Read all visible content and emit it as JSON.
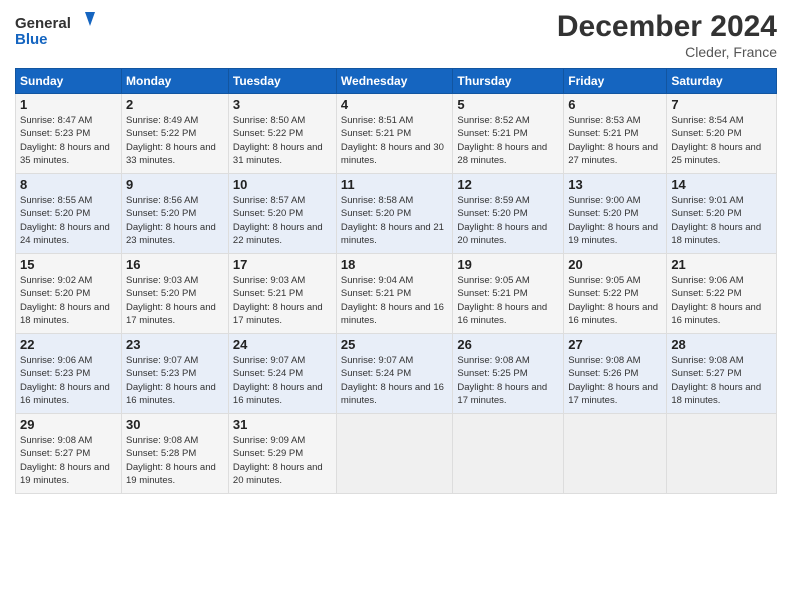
{
  "header": {
    "logo_line1": "General",
    "logo_line2": "Blue",
    "month": "December 2024",
    "location": "Cleder, France"
  },
  "days_of_week": [
    "Sunday",
    "Monday",
    "Tuesday",
    "Wednesday",
    "Thursday",
    "Friday",
    "Saturday"
  ],
  "weeks": [
    [
      {
        "day": "1",
        "sunrise": "8:47 AM",
        "sunset": "5:23 PM",
        "daylight": "8 hours and 35 minutes."
      },
      {
        "day": "2",
        "sunrise": "8:49 AM",
        "sunset": "5:22 PM",
        "daylight": "8 hours and 33 minutes."
      },
      {
        "day": "3",
        "sunrise": "8:50 AM",
        "sunset": "5:22 PM",
        "daylight": "8 hours and 31 minutes."
      },
      {
        "day": "4",
        "sunrise": "8:51 AM",
        "sunset": "5:21 PM",
        "daylight": "8 hours and 30 minutes."
      },
      {
        "day": "5",
        "sunrise": "8:52 AM",
        "sunset": "5:21 PM",
        "daylight": "8 hours and 28 minutes."
      },
      {
        "day": "6",
        "sunrise": "8:53 AM",
        "sunset": "5:21 PM",
        "daylight": "8 hours and 27 minutes."
      },
      {
        "day": "7",
        "sunrise": "8:54 AM",
        "sunset": "5:20 PM",
        "daylight": "8 hours and 25 minutes."
      }
    ],
    [
      {
        "day": "8",
        "sunrise": "8:55 AM",
        "sunset": "5:20 PM",
        "daylight": "8 hours and 24 minutes."
      },
      {
        "day": "9",
        "sunrise": "8:56 AM",
        "sunset": "5:20 PM",
        "daylight": "8 hours and 23 minutes."
      },
      {
        "day": "10",
        "sunrise": "8:57 AM",
        "sunset": "5:20 PM",
        "daylight": "8 hours and 22 minutes."
      },
      {
        "day": "11",
        "sunrise": "8:58 AM",
        "sunset": "5:20 PM",
        "daylight": "8 hours and 21 minutes."
      },
      {
        "day": "12",
        "sunrise": "8:59 AM",
        "sunset": "5:20 PM",
        "daylight": "8 hours and 20 minutes."
      },
      {
        "day": "13",
        "sunrise": "9:00 AM",
        "sunset": "5:20 PM",
        "daylight": "8 hours and 19 minutes."
      },
      {
        "day": "14",
        "sunrise": "9:01 AM",
        "sunset": "5:20 PM",
        "daylight": "8 hours and 18 minutes."
      }
    ],
    [
      {
        "day": "15",
        "sunrise": "9:02 AM",
        "sunset": "5:20 PM",
        "daylight": "8 hours and 18 minutes."
      },
      {
        "day": "16",
        "sunrise": "9:03 AM",
        "sunset": "5:20 PM",
        "daylight": "8 hours and 17 minutes."
      },
      {
        "day": "17",
        "sunrise": "9:03 AM",
        "sunset": "5:21 PM",
        "daylight": "8 hours and 17 minutes."
      },
      {
        "day": "18",
        "sunrise": "9:04 AM",
        "sunset": "5:21 PM",
        "daylight": "8 hours and 16 minutes."
      },
      {
        "day": "19",
        "sunrise": "9:05 AM",
        "sunset": "5:21 PM",
        "daylight": "8 hours and 16 minutes."
      },
      {
        "day": "20",
        "sunrise": "9:05 AM",
        "sunset": "5:22 PM",
        "daylight": "8 hours and 16 minutes."
      },
      {
        "day": "21",
        "sunrise": "9:06 AM",
        "sunset": "5:22 PM",
        "daylight": "8 hours and 16 minutes."
      }
    ],
    [
      {
        "day": "22",
        "sunrise": "9:06 AM",
        "sunset": "5:23 PM",
        "daylight": "8 hours and 16 minutes."
      },
      {
        "day": "23",
        "sunrise": "9:07 AM",
        "sunset": "5:23 PM",
        "daylight": "8 hours and 16 minutes."
      },
      {
        "day": "24",
        "sunrise": "9:07 AM",
        "sunset": "5:24 PM",
        "daylight": "8 hours and 16 minutes."
      },
      {
        "day": "25",
        "sunrise": "9:07 AM",
        "sunset": "5:24 PM",
        "daylight": "8 hours and 16 minutes."
      },
      {
        "day": "26",
        "sunrise": "9:08 AM",
        "sunset": "5:25 PM",
        "daylight": "8 hours and 17 minutes."
      },
      {
        "day": "27",
        "sunrise": "9:08 AM",
        "sunset": "5:26 PM",
        "daylight": "8 hours and 17 minutes."
      },
      {
        "day": "28",
        "sunrise": "9:08 AM",
        "sunset": "5:27 PM",
        "daylight": "8 hours and 18 minutes."
      }
    ],
    [
      {
        "day": "29",
        "sunrise": "9:08 AM",
        "sunset": "5:27 PM",
        "daylight": "8 hours and 19 minutes."
      },
      {
        "day": "30",
        "sunrise": "9:08 AM",
        "sunset": "5:28 PM",
        "daylight": "8 hours and 19 minutes."
      },
      {
        "day": "31",
        "sunrise": "9:09 AM",
        "sunset": "5:29 PM",
        "daylight": "8 hours and 20 minutes."
      },
      null,
      null,
      null,
      null
    ]
  ],
  "labels": {
    "sunrise": "Sunrise:",
    "sunset": "Sunset:",
    "daylight": "Daylight:"
  }
}
